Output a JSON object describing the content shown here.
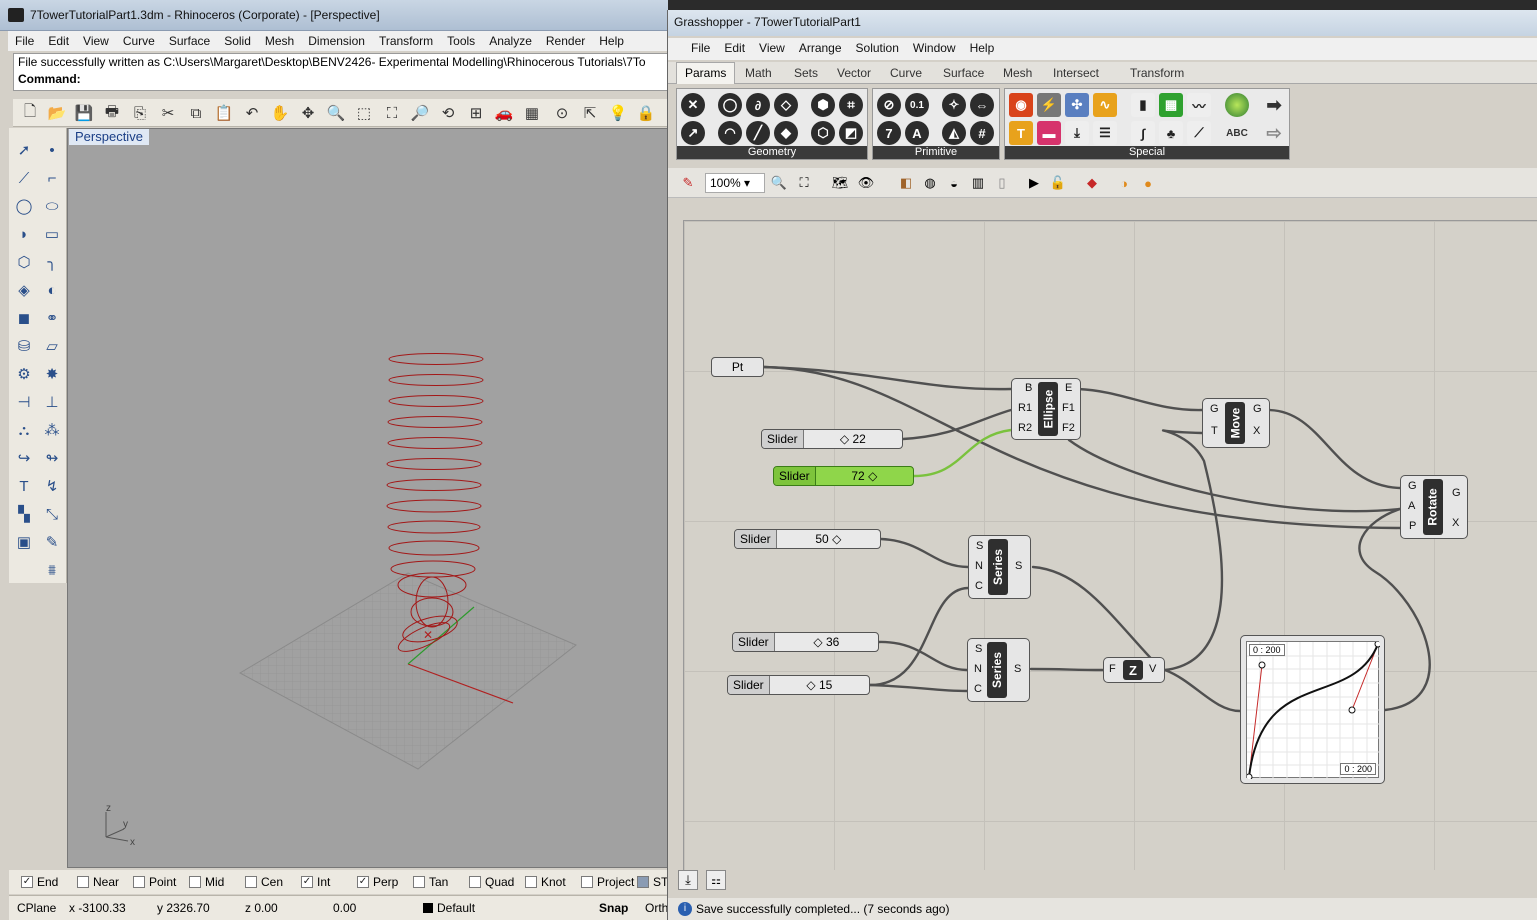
{
  "rhino": {
    "title": "7TowerTutorialPart1.3dm - Rhinoceros (Corporate) - [Perspective]",
    "menu": [
      "File",
      "Edit",
      "View",
      "Curve",
      "Surface",
      "Solid",
      "Mesh",
      "Dimension",
      "Transform",
      "Tools",
      "Analyze",
      "Render",
      "Help"
    ],
    "command_history": "File successfully written as C:\\Users\\Margaret\\Desktop\\BENV2426- Experimental Modelling\\Rhinocerous Tutorials\\7To",
    "command_label": "Command:",
    "viewport_label": "Perspective",
    "axes": {
      "z": "z",
      "y": "y",
      "x": "x"
    },
    "osnaps": [
      {
        "label": "End",
        "checked": true
      },
      {
        "label": "Near",
        "checked": false
      },
      {
        "label": "Point",
        "checked": false
      },
      {
        "label": "Mid",
        "checked": false
      },
      {
        "label": "Cen",
        "checked": false
      },
      {
        "label": "Int",
        "checked": true
      },
      {
        "label": "Perp",
        "checked": true
      },
      {
        "label": "Tan",
        "checked": false
      },
      {
        "label": "Quad",
        "checked": false
      },
      {
        "label": "Knot",
        "checked": false
      },
      {
        "label": "Project",
        "checked": false
      },
      {
        "label": "ST",
        "checked": false
      }
    ],
    "status": {
      "cplane": "CPlane",
      "x": "x -3100.33",
      "y": "y 2326.70",
      "z": "z 0.00",
      "dist": "0.00",
      "layer": "Default",
      "snap": "Snap",
      "ortho": "Orth"
    }
  },
  "grasshopper": {
    "title": "Grasshopper - 7TowerTutorialPart1",
    "menu": [
      "File",
      "Edit",
      "View",
      "Arrange",
      "Solution",
      "Window",
      "Help"
    ],
    "tabs": [
      "Params",
      "Math",
      "Sets",
      "Vector",
      "Curve",
      "Surface",
      "Mesh",
      "Intersect",
      "Transform"
    ],
    "active_tab": "Params",
    "ribbon_groups": [
      "Geometry",
      "Primitive",
      "Special"
    ],
    "primitive_icons": {
      "number": "0.1",
      "integer": "7",
      "text": "A"
    },
    "special_icon_text": "ABC",
    "zoom": "100%",
    "status_message": "Save successfully completed... (7 seconds ago)",
    "components": {
      "pt": {
        "label": "Pt"
      },
      "ellipse": {
        "name": "Ellipse",
        "inputs": [
          "B",
          "R1",
          "R2"
        ],
        "outputs": [
          "E",
          "F1",
          "F2"
        ]
      },
      "move": {
        "name": "Move",
        "inputs": [
          "G",
          "T"
        ],
        "outputs": [
          "G",
          "X"
        ]
      },
      "rotate": {
        "name": "Rotate",
        "inputs": [
          "G",
          "A",
          "P"
        ],
        "outputs": [
          "G",
          "X"
        ]
      },
      "series1": {
        "name": "Series",
        "inputs": [
          "S",
          "N",
          "C"
        ],
        "outputs": [
          "S"
        ]
      },
      "series2": {
        "name": "Series",
        "inputs": [
          "S",
          "N",
          "C"
        ],
        "outputs": [
          "S"
        ]
      },
      "unitz": {
        "input": "F",
        "output": "V",
        "name": "Z"
      },
      "graph": {
        "range_top": "0 : 200",
        "range_bottom": "0 : 200"
      }
    },
    "sliders": [
      {
        "label": "Slider",
        "value": "22"
      },
      {
        "label": "Slider",
        "value": "72"
      },
      {
        "label": "Slider",
        "value": "50"
      },
      {
        "label": "Slider",
        "value": "36"
      },
      {
        "label": "Slider",
        "value": "15"
      }
    ]
  },
  "colors": {
    "curve_red": "#a31818",
    "slider_green": "#8fd64a",
    "wire": "#505050",
    "wire_green": "#7ac23d"
  }
}
